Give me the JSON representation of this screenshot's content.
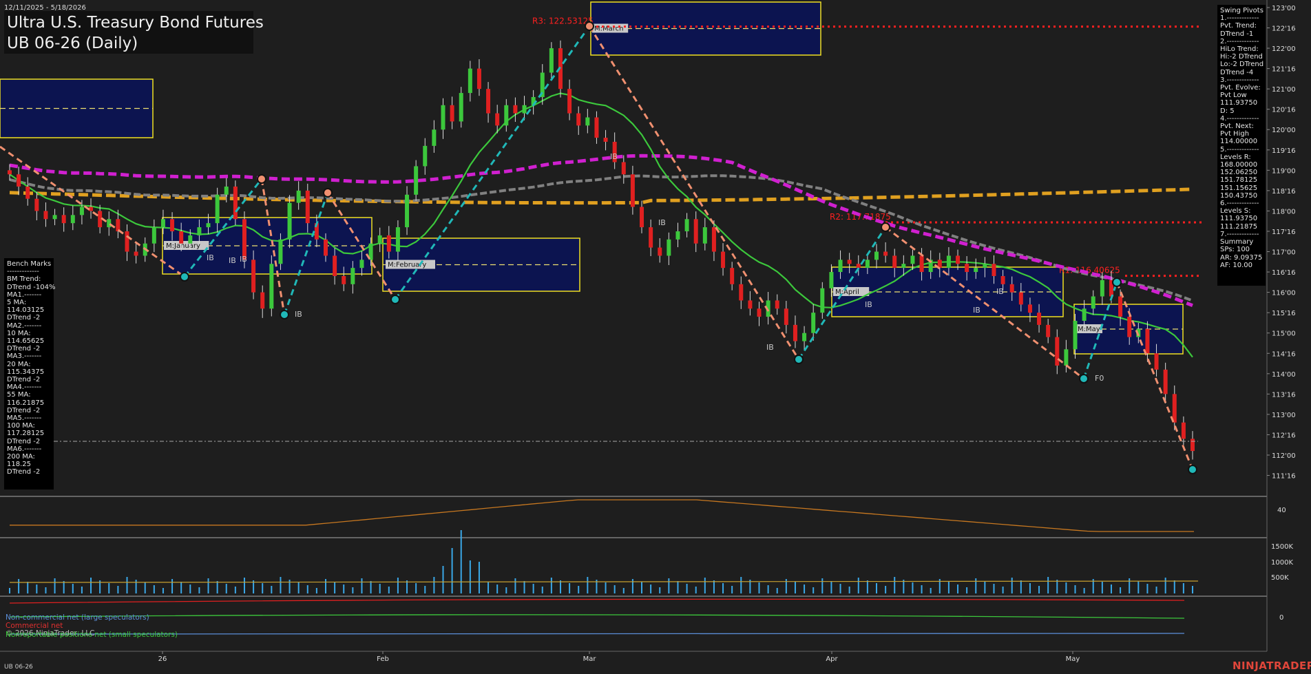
{
  "header": {
    "date_range": "12/11/2025 - 5/18/2026",
    "title_line1": "Ultra U.S. Treasury Bond Futures",
    "title_line2": "UB 06-26 (Daily)"
  },
  "footer": {
    "symbol": "UB 06-26",
    "brand": "NINJATRADER",
    "copyright": "© 2026 NinjaTrader, LLC"
  },
  "swing_panel": {
    "lines": [
      "Swing Pivots",
      "1.-------------",
      "Pvt. Trend:",
      "DTrend -1",
      "2.-------------",
      "HiLo Trend:",
      "Hi:-2 DTrend",
      "Lo:-2 DTrend",
      "DTrend -4",
      "3.-------------",
      "Pvt. Evolve:",
      "Pvt Low",
      "111.93750",
      "D: 5",
      "4.-------------",
      "Pvt. Next:",
      "Pvt High",
      "114.00000",
      "5.-------------",
      "Levels R:",
      "168.00000",
      "152.06250",
      "151.78125",
      "151.15625",
      "150.43750",
      "6.-------------",
      "Levels S:",
      "111.93750",
      "111.21875",
      "7.-------------",
      "Summary",
      "SPs: 100",
      "AR: 9.09375",
      "AF: 10.00"
    ]
  },
  "bench_panel": {
    "lines": [
      "Bench Marks",
      "-------------",
      "BM Trend:",
      "DTrend -104%",
      "MA1.-------",
      "5 MA:",
      "114.03125",
      "DTrend -2",
      "MA2.-------",
      "10 MA:",
      "114.65625",
      "DTrend -2",
      "MA3.-------",
      "20 MA:",
      "115.34375",
      "DTrend -2",
      "MA4.-------",
      "55 MA:",
      "116.21875",
      "DTrend -2",
      "MA5.-------",
      "100 MA:",
      "117.28125",
      "DTrend -2",
      "MA6.-------",
      "200 MA:",
      "118.25",
      "DTrend -2"
    ]
  },
  "cot_legend": {
    "noncommercial": "Non-commercial net (large speculators)",
    "commercial": "Commercial net",
    "nonreportable": "Nonreportable positions net (small speculators)"
  },
  "chart_data": {
    "type": "candlestick",
    "instrument": "UB 06-26",
    "timeframe": "Daily",
    "ylim": [
      111.34,
      123.05
    ],
    "y_ticks": [
      "123'00",
      "122'16",
      "122'00",
      "121'16",
      "121'00",
      "120'16",
      "120'00",
      "119'16",
      "119'00",
      "118'16",
      "118'00",
      "117'16",
      "117'00",
      "116'16",
      "116'00",
      "115'16",
      "115'00",
      "114'16",
      "114'00",
      "113'16",
      "113'00",
      "112'16",
      "112'00",
      "111'16"
    ],
    "x_labels": [
      "26",
      "Feb",
      "Mar",
      "Apr",
      "May"
    ],
    "levels": [
      {
        "label": "R3: 122.53125",
        "value": 122.53125,
        "color": "#ff2020"
      },
      {
        "label": "R2: 117.71875",
        "value": 117.71875,
        "color": "#ff2020"
      },
      {
        "label": "R1: 116.40625",
        "value": 116.40625,
        "color": "#ff2020"
      }
    ],
    "last_price": 112.55,
    "close_series": [
      118.9,
      118.6,
      118.3,
      118.0,
      117.8,
      117.9,
      117.7,
      117.9,
      118.1,
      118.0,
      117.6,
      117.8,
      117.5,
      117.0,
      116.9,
      117.2,
      117.6,
      117.8,
      117.5,
      117.2,
      117.4,
      117.6,
      117.7,
      118.4,
      118.6,
      117.8,
      116.8,
      116.0,
      115.6,
      116.7,
      117.3,
      118.2,
      118.5,
      117.7,
      117.3,
      116.9,
      116.4,
      116.2,
      116.6,
      116.8,
      117.2,
      117.4,
      117.0,
      117.6,
      118.4,
      119.1,
      119.6,
      120.0,
      120.6,
      120.2,
      120.9,
      121.5,
      121.0,
      120.4,
      120.1,
      120.6,
      120.4,
      120.6,
      120.8,
      121.4,
      122.0,
      121.0,
      120.4,
      120.1,
      120.3,
      119.8,
      119.7,
      119.2,
      118.9,
      118.1,
      117.6,
      117.1,
      116.9,
      117.3,
      117.5,
      117.8,
      117.2,
      117.6,
      117.0,
      116.6,
      116.2,
      115.8,
      115.6,
      115.4,
      115.8,
      115.6,
      115.2,
      114.8,
      115.0,
      115.5,
      116.1,
      116.5,
      116.8,
      116.7,
      116.6,
      116.8,
      117.0,
      116.9,
      116.6,
      116.7,
      116.9,
      116.5,
      116.8,
      116.6,
      116.9,
      116.7,
      116.5,
      116.6,
      116.7,
      116.4,
      116.2,
      116.0,
      115.7,
      115.5,
      115.2,
      114.9,
      114.2,
      114.6,
      115.3,
      115.6,
      115.9,
      116.3,
      115.9,
      115.4,
      114.9,
      115.1,
      114.5,
      114.1,
      113.5,
      112.8,
      112.4,
      112.1
    ],
    "moving_averages": [
      {
        "name": "5 MA",
        "value": 114.03125
      },
      {
        "name": "10 MA",
        "value": 114.65625
      },
      {
        "name": "20 MA",
        "value": 115.34375
      },
      {
        "name": "55 MA",
        "value": 116.21875
      },
      {
        "name": "100 MA",
        "value": 117.28125
      },
      {
        "name": "200 MA",
        "value": 118.25
      }
    ],
    "monthly_boxes": [
      {
        "label": "M:January"
      },
      {
        "label": "M:February"
      },
      {
        "label": "M:March"
      },
      {
        "label": "M:April"
      },
      {
        "label": "M:May"
      }
    ],
    "markers": [
      "IB",
      "IB",
      "IB",
      "IB",
      "IB",
      "IB",
      "IB",
      "IB",
      "IB",
      "IB",
      "F0"
    ],
    "panel2": {
      "axis_ticks": [
        "40"
      ]
    },
    "panel3": {
      "axis_ticks": [
        "1500K",
        "1000K",
        "500K"
      ]
    },
    "panel4": {
      "axis_ticks": [
        "0"
      ]
    },
    "colors": {
      "up": "#3cc83c",
      "down": "#e02020",
      "ma20": "#3cc83c",
      "ma55": "#d020d0",
      "ma100": "#808080",
      "ma200": "#e0a020",
      "box_fill": "#0c1450",
      "box_edge": "#f0e020",
      "swing_up": "#20b8b8",
      "swing_down": "#f09070"
    }
  }
}
